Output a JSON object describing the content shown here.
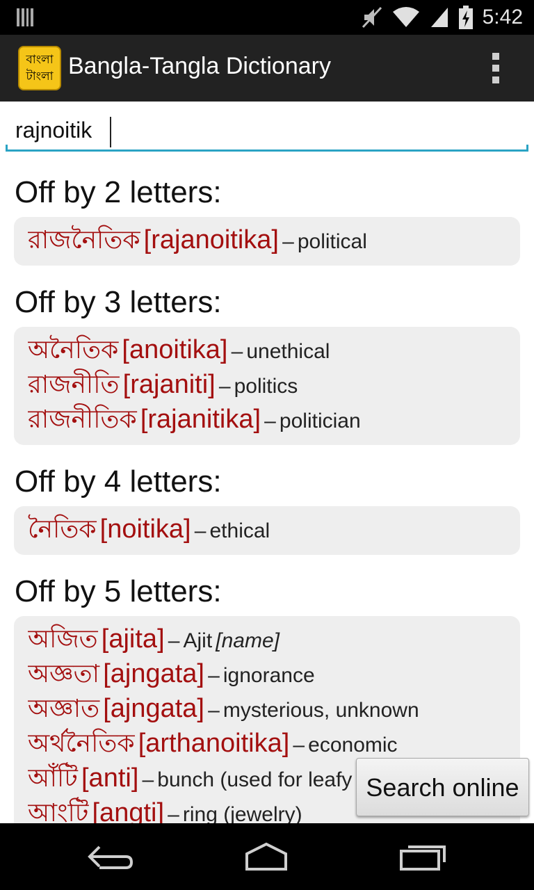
{
  "status_bar": {
    "time": "5:42",
    "icons": [
      "notification-icon",
      "mute-icon",
      "wifi-icon",
      "signal-icon",
      "battery-charging-icon"
    ]
  },
  "app_bar": {
    "logo_line1": "বাংলা",
    "logo_line2": "টাংলা",
    "title": "Bangla-Tangla Dictionary",
    "menu_icon": "overflow-menu-icon"
  },
  "search": {
    "value": "rajnoitik"
  },
  "results": [
    {
      "heading": "Off by 2 letters:",
      "entries": [
        {
          "bangla": "রাজনৈতিক",
          "translit": "[rajanoitika]",
          "dash": "–",
          "meaning": "political"
        }
      ]
    },
    {
      "heading": "Off by 3 letters:",
      "entries": [
        {
          "bangla": "অনৈতিক",
          "translit": "[anoitika]",
          "dash": "–",
          "meaning": "unethical"
        },
        {
          "bangla": "রাজনীতি",
          "translit": "[rajaniti]",
          "dash": "–",
          "meaning": "politics"
        },
        {
          "bangla": "রাজনীতিক",
          "translit": "[rajanitika]",
          "dash": "–",
          "meaning": "politician"
        }
      ]
    },
    {
      "heading": "Off by 4 letters:",
      "entries": [
        {
          "bangla": "নৈতিক",
          "translit": "[noitika]",
          "dash": "–",
          "meaning": "ethical"
        }
      ]
    },
    {
      "heading": "Off by 5 letters:",
      "entries": [
        {
          "bangla": "অজিত",
          "translit": "[ajita]",
          "dash": "–",
          "meaning": "Ajit",
          "note": "[name]"
        },
        {
          "bangla": "অজ্ঞতা",
          "translit": "[ajngata]",
          "dash": "–",
          "meaning": "ignorance"
        },
        {
          "bangla": "অজ্ঞাত",
          "translit": "[ajngata]",
          "dash": "–",
          "meaning": "mysterious, unknown"
        },
        {
          "bangla": "অর্থনৈতিক",
          "translit": "[arthanoitika]",
          "dash": "–",
          "meaning": "economic"
        },
        {
          "bangla": "আঁটি",
          "translit": "[anti]",
          "dash": "–",
          "meaning": "bunch (used for leafy greens)"
        },
        {
          "bangla": "আংটি",
          "translit": "[angti]",
          "dash": "–",
          "meaning": "ring (jewelry)"
        }
      ]
    }
  ],
  "search_online_button": "Search online",
  "nav_bar": {
    "icons": [
      "back-icon",
      "home-icon",
      "recent-apps-icon"
    ]
  }
}
